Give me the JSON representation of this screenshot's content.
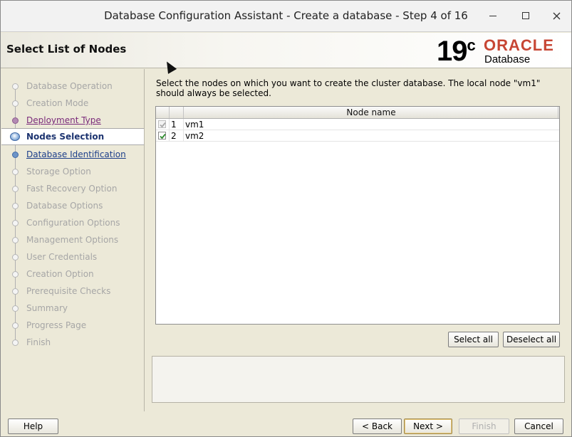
{
  "window": {
    "title": "Database Configuration Assistant - Create a database - Step 4 of 16"
  },
  "header": {
    "heading": "Select List of Nodes",
    "logo": {
      "version": "19",
      "version_suffix": "c",
      "brand": "ORACLE",
      "product": "Database"
    }
  },
  "nav": {
    "items": [
      {
        "label": "Database Operation",
        "state": "disabled"
      },
      {
        "label": "Creation Mode",
        "state": "disabled"
      },
      {
        "label": "Deployment Type",
        "state": "visited"
      },
      {
        "label": "Nodes Selection",
        "state": "active"
      },
      {
        "label": "Database Identification",
        "state": "link"
      },
      {
        "label": "Storage Option",
        "state": "disabled"
      },
      {
        "label": "Fast Recovery Option",
        "state": "disabled"
      },
      {
        "label": "Database Options",
        "state": "disabled"
      },
      {
        "label": "Configuration Options",
        "state": "disabled"
      },
      {
        "label": "Management Options",
        "state": "disabled"
      },
      {
        "label": "User Credentials",
        "state": "disabled"
      },
      {
        "label": "Creation Option",
        "state": "disabled"
      },
      {
        "label": "Prerequisite Checks",
        "state": "disabled"
      },
      {
        "label": "Summary",
        "state": "disabled"
      },
      {
        "label": "Progress Page",
        "state": "disabled"
      },
      {
        "label": "Finish",
        "state": "disabled"
      }
    ]
  },
  "content": {
    "description": "Select the nodes on which you want to create the cluster database. The local node \"vm1\" should always be selected.",
    "table": {
      "column_header": "Node name",
      "rows": [
        {
          "index": "1",
          "name": "vm1",
          "checked": true,
          "enabled": false
        },
        {
          "index": "2",
          "name": "vm2",
          "checked": true,
          "enabled": true
        }
      ]
    },
    "select_all_label": "Select all",
    "deselect_all_label": "Deselect all"
  },
  "footer": {
    "help_label": "Help",
    "back_label": "< Back",
    "next_label": "Next >",
    "finish_label": "Finish",
    "cancel_label": "Cancel"
  },
  "colors": {
    "oracle_red": "#c74634",
    "active_text": "#1d3470",
    "link_text": "#1d3f8a",
    "visited_text": "#7a2a7a",
    "check_green": "#2e8b2e"
  }
}
